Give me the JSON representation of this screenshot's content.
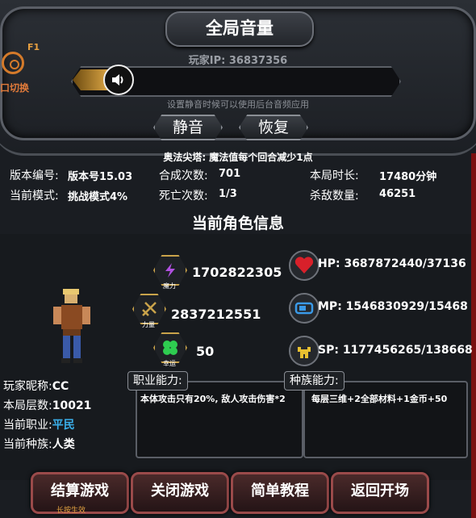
{
  "volume_panel": {
    "title": "全局音量",
    "player_ip": "玩家IP: 36837356",
    "hint": "设置静音时候可以使用后台音频应用",
    "mute_label": "静音",
    "restore_label": "恢复",
    "volume_level": 0.12
  },
  "f1": {
    "key": "F1",
    "label": "口切换"
  },
  "tip": "奥法尖塔: 魔法值每个回合减少1点",
  "stats": {
    "version_label": "版本编号:",
    "version_value": "版本号15.03",
    "mode_label": "当前模式:",
    "mode_value": "挑战模式4%",
    "synth_label": "合成次数:",
    "synth_value": "701",
    "death_label": "死亡次数:",
    "death_value": "1/3",
    "duration_label": "本局时长:",
    "duration_value": "17480分钟",
    "kills_label": "杀敌数量:",
    "kills_value": "46251"
  },
  "character": {
    "section_title": "当前角色信息",
    "magic_caption": "魔力",
    "magic_value": "1702822305",
    "power_caption": "力量",
    "power_value": "2837212551",
    "luck_caption": "幸运",
    "luck_value": "50",
    "hp_label": "HP:",
    "hp_value": "3687872440/37136",
    "mp_label": "MP:",
    "mp_value": "1546830929/15468",
    "sp_label": "SP:",
    "sp_value": "1177456265/138668",
    "nickname_label": "玩家昵称:",
    "nickname_value": "CC",
    "floor_label": "本局层数:",
    "floor_value": "10021",
    "job_label": "当前职业:",
    "job_value": "平民",
    "race_label": "当前种族:",
    "race_value": "人类",
    "job_ability_tag": "职业能力:",
    "job_ability_text": "本体攻击只有20%, 敌人攻击伤害*2",
    "race_ability_tag": "种族能力:",
    "race_ability_text": "每层三维+2全部材料+1金币+50"
  },
  "buttons": {
    "settle": "结算游戏",
    "settle_sub": "长按生效",
    "close": "关闭游戏",
    "tutorial": "简单教程",
    "back": "返回开场"
  },
  "colors": {
    "accent": "#c9a34a",
    "job_value": "#3aaee8",
    "hp": "#d8202a",
    "danger_btn": "#9a4a4a"
  }
}
